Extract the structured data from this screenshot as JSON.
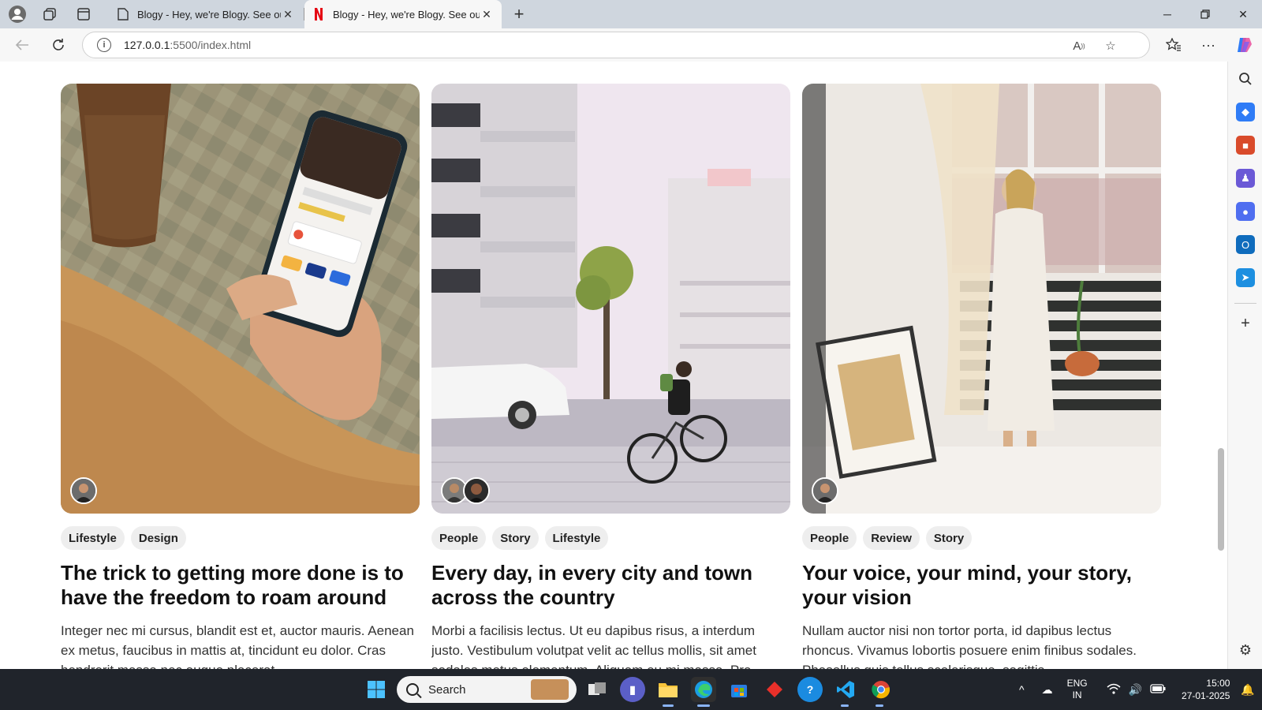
{
  "browser": {
    "tabs": [
      {
        "title": "Blogy - Hey, we're Blogy. See our",
        "icon": "page-icon"
      },
      {
        "title": "Blogy - Hey, we're Blogy. See our",
        "icon": "netflix-n-icon"
      }
    ],
    "address": {
      "host": "127.0.0.1",
      "rest": ":5500/index.html"
    }
  },
  "cards": [
    {
      "tags": [
        "Lifestyle",
        "Design"
      ],
      "title": "The trick to getting more done is to have the freedom to roam around",
      "excerpt": "Integer nec mi cursus, blandit est et, auctor mauris. Aenean ex metus, faucibus in mattis at, tincidunt eu dolor. Cras hendrerit massa nec augue placerat...",
      "authors": 1
    },
    {
      "tags": [
        "People",
        "Story",
        "Lifestyle"
      ],
      "title": "Every day, in every city and town across the country",
      "excerpt": "Morbi a facilisis lectus. Ut eu dapibus risus, a interdum justo. Vestibulum volutpat velit ac tellus mollis, sit amet sodales metus elementum. Aliquam eu mi massa. Pro...",
      "authors": 2
    },
    {
      "tags": [
        "People",
        "Review",
        "Story"
      ],
      "title": "Your voice, your mind, your story, your vision",
      "excerpt": "Nullam auctor nisi non tortor porta, id dapibus lectus rhoncus. Vivamus lobortis posuere enim finibus sodales. Phasellus quis tellus scelerisque, sagittis...",
      "authors": 1
    }
  ],
  "taskbar": {
    "search_placeholder": "Search",
    "lang_line1": "ENG",
    "lang_line2": "IN",
    "time": "15:00",
    "date": "27-01-2025"
  }
}
